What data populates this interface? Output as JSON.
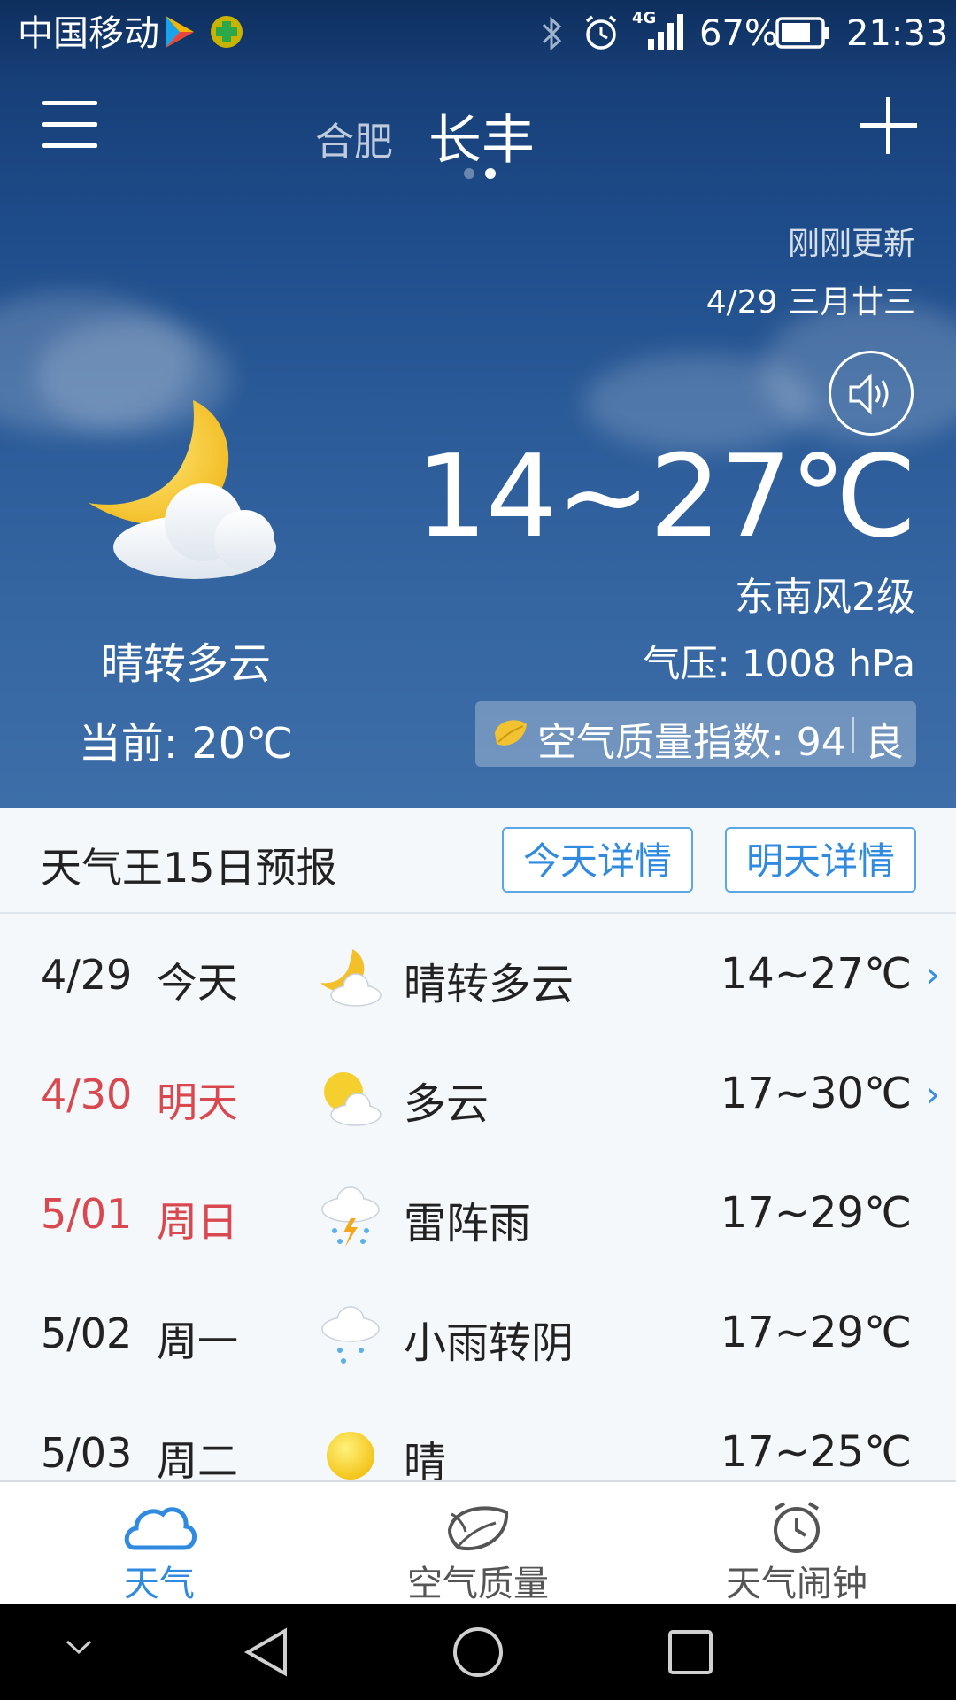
{
  "status_bar": {
    "carrier": "中国移动",
    "network": "4G",
    "battery": "67%",
    "time": "21:33"
  },
  "header": {
    "city_prev": "合肥",
    "city_current": "长丰",
    "page_indicator": {
      "count": 2,
      "active": 1
    }
  },
  "hero": {
    "updated": "刚刚更新",
    "date": "4/29 三月廿三",
    "temp_range": "14~27℃",
    "wind": "东南风2级",
    "pressure": "气压: 1008 hPa",
    "aqi": {
      "label": "空气质量指数: 94",
      "level": "良"
    },
    "condition": "晴转多云",
    "current": "当前: 20℃"
  },
  "forecast": {
    "title": "天气王15日预报",
    "today_btn": "今天详情",
    "tomorrow_btn": "明天详情",
    "rows": [
      {
        "date": "4/29",
        "day": "今天",
        "icon": "moon-cloud-icon",
        "cond": "晴转多云",
        "temp": "14~27℃",
        "highlight": false,
        "chevron": "›"
      },
      {
        "date": "4/30",
        "day": "明天",
        "icon": "sun-cloud-icon",
        "cond": "多云",
        "temp": "17~30℃",
        "highlight": true,
        "chevron": "›"
      },
      {
        "date": "5/01",
        "day": "周日",
        "icon": "thunderstorm-icon",
        "cond": "雷阵雨",
        "temp": "17~29℃",
        "highlight": true,
        "chevron": ""
      },
      {
        "date": "5/02",
        "day": "周一",
        "icon": "light-rain-icon",
        "cond": "小雨转阴",
        "temp": "17~29℃",
        "highlight": false,
        "chevron": ""
      },
      {
        "date": "5/03",
        "day": "周二",
        "icon": "sun-icon",
        "cond": "晴",
        "temp": "17~25℃",
        "highlight": false,
        "chevron": ""
      }
    ]
  },
  "tabs": [
    {
      "label": "天气",
      "icon": "cloud-icon",
      "active": true
    },
    {
      "label": "空气质量",
      "icon": "leaf-icon",
      "active": false
    },
    {
      "label": "天气闹钟",
      "icon": "alarm-clock-icon",
      "active": false
    }
  ],
  "colors": {
    "accent": "#2f8ae0",
    "highlight_red": "#d9474f",
    "text_dark": "#222222"
  }
}
